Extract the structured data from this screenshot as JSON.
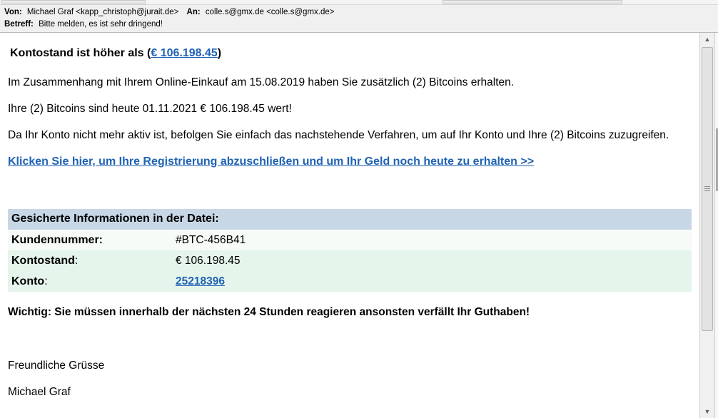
{
  "header": {
    "from_label": "Von:",
    "from_value": "Michael Graf <kapp_christoph@jurait.de>",
    "to_label": "An:",
    "to_value": "colle.s@gmx.de <colle.s@gmx.de>",
    "subject_label": "Betreff:",
    "subject_value": "Bitte melden, es ist sehr dringend!"
  },
  "body": {
    "title_prefix": "Kontostand ist höher als (",
    "title_amount": "€ 106.198.45",
    "title_suffix": ")",
    "para1": "Im Zusammenhang mit Ihrem Online-Einkauf am 15.08.2019 haben Sie zusätzlich (2) Bitcoins erhalten.",
    "para2": "Ihre (2) Bitcoins sind heute 01.11.2021 € 106.198.45 wert!",
    "para3": "Da Ihr Konto nicht mehr aktiv ist, befolgen Sie einfach das nachstehende Verfahren, um auf Ihr Konto und Ihre (2) Bitcoins zuzugreifen.",
    "cta_link": "Klicken Sie hier, um Ihre Registrierung abzuschließen und um Ihr Geld noch heute zu erhalten >>",
    "table": {
      "heading": "Gesicherte Informationen in der Datei:",
      "rows": [
        {
          "key_bold": "Kundennummer:",
          "key_rest": "",
          "value": "#BTC-456B41"
        },
        {
          "key_bold": "Kontostand",
          "key_rest": ":",
          "value": "€ 106.198.45"
        },
        {
          "key_bold": "Konto",
          "key_rest": ":",
          "value": "25218396"
        }
      ]
    },
    "warning": "Wichtig:  Sie müssen innerhalb der nächsten 24 Stunden reagieren ansonsten verfällt Ihr Guthaben!",
    "greeting": "Freundliche Grüsse",
    "signature": "Michael Graf"
  },
  "colors": {
    "link": "#1f63b4",
    "table_header_bg": "#c7d7e6",
    "row_light_bg": "#f6fbf7",
    "row_green_bg": "#e5f5ec"
  }
}
